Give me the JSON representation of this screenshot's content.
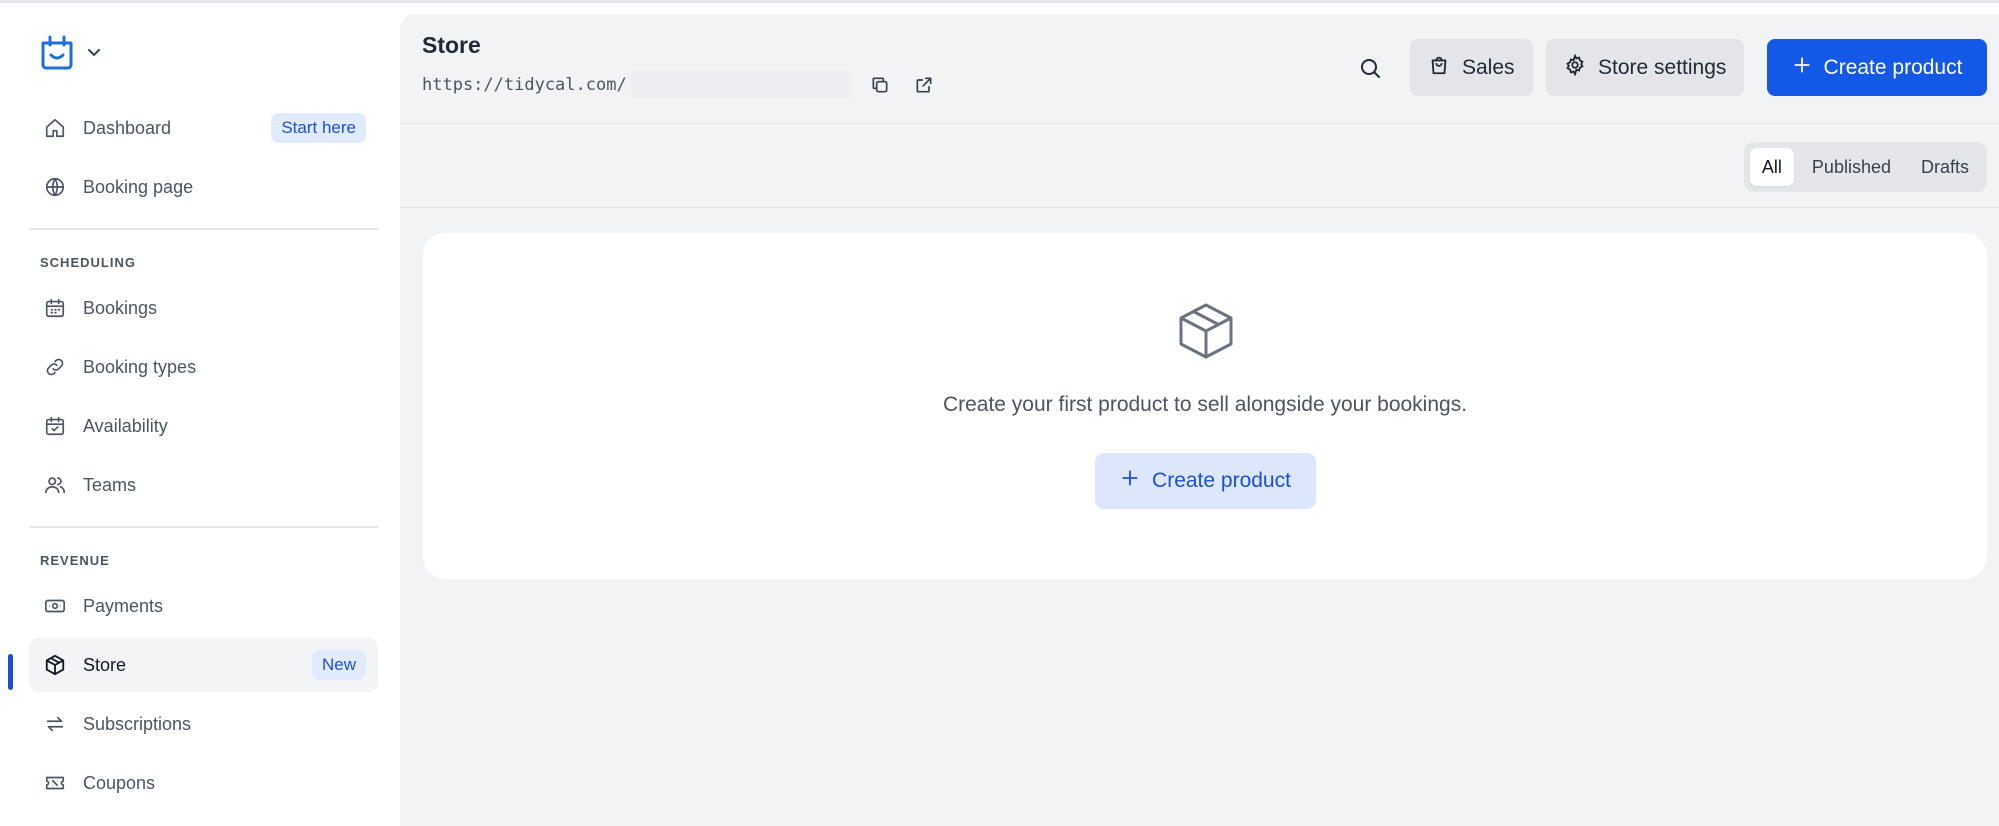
{
  "sidebar": {
    "items": [
      {
        "label": "Dashboard",
        "badge": "Start here"
      },
      {
        "label": "Booking page"
      },
      {
        "label": "Bookings"
      },
      {
        "label": "Booking types"
      },
      {
        "label": "Availability"
      },
      {
        "label": "Teams"
      },
      {
        "label": "Payments"
      },
      {
        "label": "Store",
        "badge": "New"
      },
      {
        "label": "Subscriptions"
      },
      {
        "label": "Coupons"
      }
    ],
    "sections": {
      "scheduling": "SCHEDULING",
      "revenue": "REVENUE"
    },
    "active_item": "Store"
  },
  "header": {
    "title": "Store",
    "url": "https://tidycal.com/",
    "sales_label": "Sales",
    "store_settings_label": "Store settings",
    "create_product_label": "Create product"
  },
  "filters": {
    "all": "All",
    "published": "Published",
    "drafts": "Drafts",
    "selected": "All"
  },
  "empty_state": {
    "message": "Create your first product to sell alongside your bookings.",
    "button_label": "Create product"
  },
  "colors": {
    "accent": "#1458e8",
    "badge_bg": "#e0ebff",
    "badge_text": "#1d4ed8",
    "main_bg": "#f1f3f5"
  },
  "icons": {
    "logo": "calendar-smile-icon",
    "dashboard": "home-icon",
    "booking_page": "globe-icon",
    "bookings": "calendar-icon",
    "booking_types": "link-icon",
    "availability": "calendar-check-icon",
    "teams": "users-icon",
    "payments": "cash-icon",
    "store": "cube-icon",
    "subscriptions": "repeat-icon",
    "coupons": "ticket-icon"
  }
}
